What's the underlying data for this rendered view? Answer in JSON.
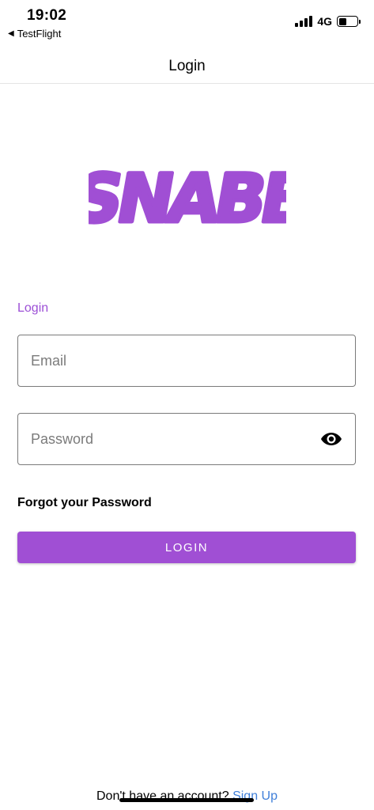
{
  "status_bar": {
    "time": "19:02",
    "back_app": "TestFlight",
    "network": "4G",
    "battery_level": 0.45
  },
  "nav": {
    "title": "Login"
  },
  "logo": {
    "text": "SNABB",
    "color": "#a04fd4"
  },
  "form": {
    "section_label": "Login",
    "email": {
      "value": "",
      "placeholder": "Email"
    },
    "password": {
      "value": "",
      "placeholder": "Password"
    },
    "forgot_label": "Forgot your Password",
    "login_button": "LOGIN"
  },
  "footer": {
    "prompt": "Don't have an account?",
    "signup_link": "Sign Up"
  },
  "colors": {
    "accent": "#a04fd4",
    "link": "#3f7fd9"
  }
}
